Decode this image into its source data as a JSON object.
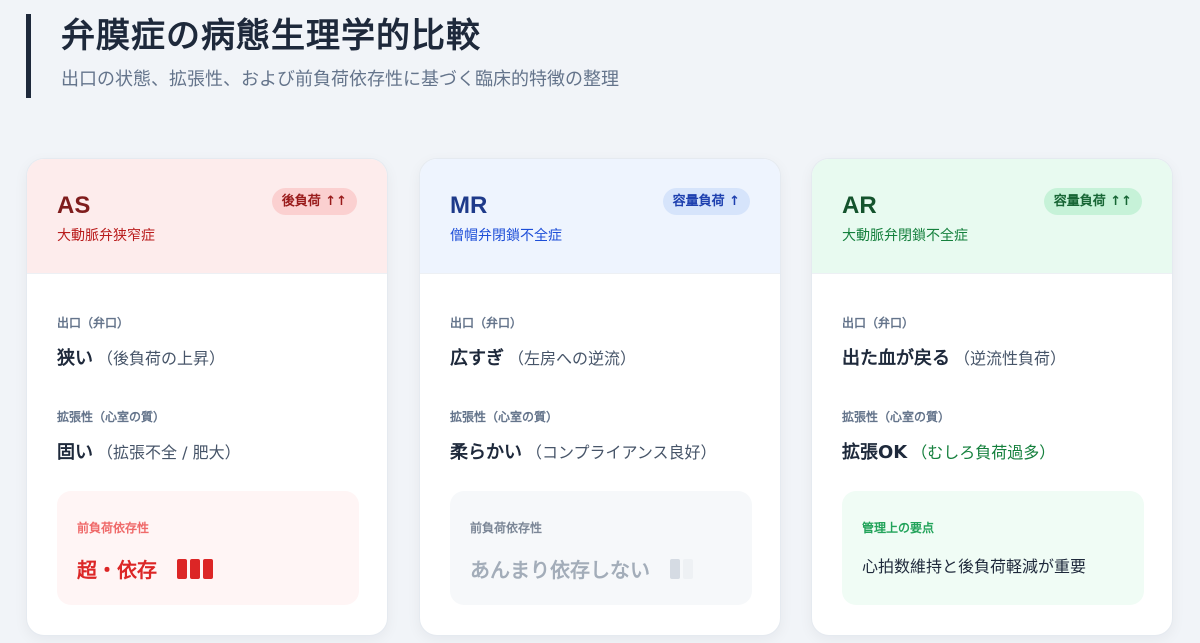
{
  "header": {
    "title": "弁膜症の病態生理学的比較",
    "subtitle": "出口の状態、拡張性、および前負荷依存性に基づく臨床的特徴の整理"
  },
  "cards": [
    {
      "abbr": "AS",
      "name": "大動脈弁狭窄症",
      "badge": "後負荷 ↑↑",
      "outlet_label": "出口（弁口）",
      "outlet_value": "狭い",
      "outlet_note": "（後負荷の上昇）",
      "compliance_label": "拡張性（心室の質）",
      "compliance_value": "固い",
      "compliance_note": "（拡張不全 / 肥大）",
      "box_label": "前負荷依存性",
      "box_value": "超・依存",
      "dependency_level": 3,
      "dependency_max": 3
    },
    {
      "abbr": "MR",
      "name": "僧帽弁閉鎖不全症",
      "badge": "容量負荷 ↑",
      "outlet_label": "出口（弁口）",
      "outlet_value": "広すぎ",
      "outlet_note": "（左房への逆流）",
      "compliance_label": "拡張性（心室の質）",
      "compliance_value": "柔らかい",
      "compliance_note": "（コンプライアンス良好）",
      "box_label": "前負荷依存性",
      "box_value": "あんまり依存しない",
      "dependency_level": 1,
      "dependency_max": 2
    },
    {
      "abbr": "AR",
      "name": "大動脈弁閉鎖不全症",
      "badge": "容量負荷 ↑↑",
      "outlet_label": "出口（弁口）",
      "outlet_value": "出た血が戻る",
      "outlet_note": "（逆流性負荷）",
      "compliance_label": "拡張性（心室の質）",
      "compliance_value": "拡張OK",
      "compliance_note": "（むしろ負荷過多）",
      "box_label": "管理上の要点",
      "box_value": "心拍数維持と後負荷軽減が重要"
    }
  ],
  "colors": {
    "as_accent": "#dc2626",
    "mr_accent": "#1d4ed8",
    "ar_accent": "#15803d",
    "background": "#f1f4f8"
  }
}
